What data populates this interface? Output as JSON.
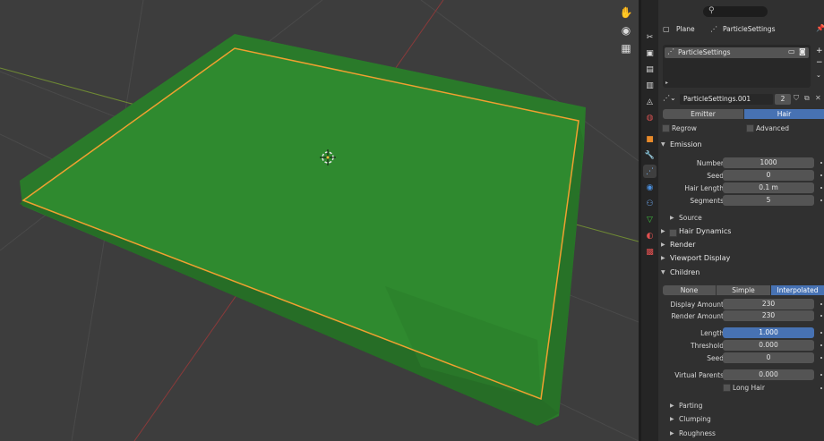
{
  "viewport": {
    "tools": [
      "hand-icon",
      "camera-icon",
      "grid-icon"
    ]
  },
  "properties": {
    "header": {
      "object": "Plane",
      "particle_system": "ParticleSettings",
      "search_placeholder": ""
    },
    "list_item": "ParticleSettings",
    "datablock": {
      "name": "ParticleSettings.001",
      "users": "2"
    },
    "type_tabs": [
      "Emitter",
      "Hair"
    ],
    "active_type": "Hair",
    "options": {
      "regrow": "Regrow",
      "advanced": "Advanced"
    },
    "emission": {
      "title": "Emission",
      "number_label": "Number",
      "number": "1000",
      "seed_label": "Seed",
      "seed": "0",
      "hair_length_label": "Hair Length",
      "hair_length": "0.1 m",
      "segments_label": "Segments",
      "segments": "5",
      "source": "Source"
    },
    "hair_dynamics": "Hair Dynamics",
    "render": "Render",
    "viewport_display": "Viewport Display",
    "children": {
      "title": "Children",
      "modes": [
        "None",
        "Simple",
        "Interpolated"
      ],
      "active_mode": "Interpolated",
      "display_amount_label": "Display Amount",
      "display_amount": "230",
      "render_amount_label": "Render Amount",
      "render_amount": "230",
      "length_label": "Length",
      "length": "1.000",
      "threshold_label": "Threshold",
      "threshold": "0.000",
      "seed_label": "Seed",
      "seed": "0",
      "virtual_parents_label": "Virtual Parents",
      "virtual_parents": "0.000",
      "long_hair": "Long Hair",
      "parting": "Parting",
      "clumping": "Clumping",
      "roughness": "Roughness"
    }
  },
  "colors": {
    "accent": "#4772b3",
    "grass": "#2f8a2f",
    "selection": "#f0a030"
  }
}
